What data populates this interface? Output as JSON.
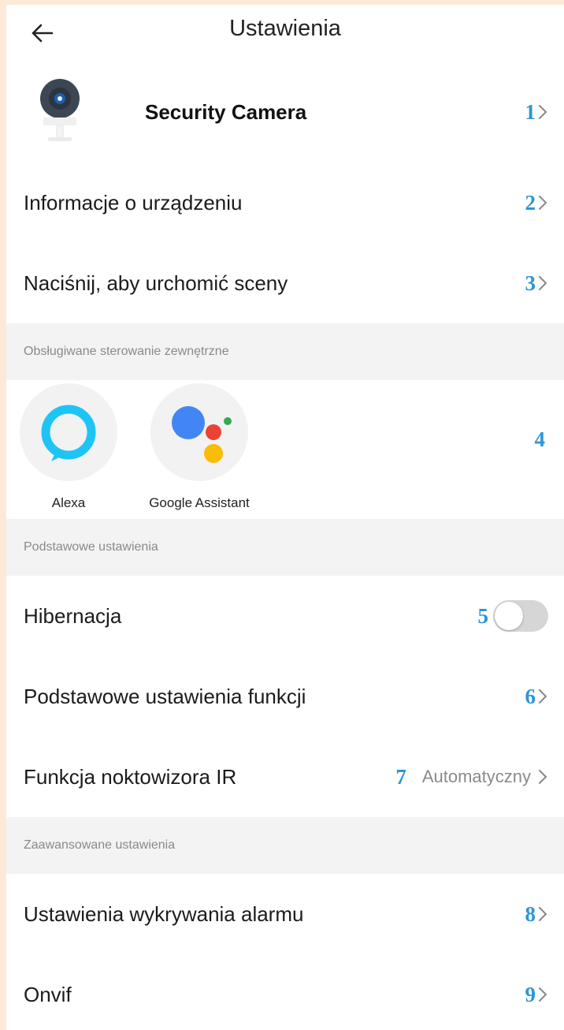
{
  "header": {
    "title": "Ustawienia"
  },
  "device": {
    "name": "Security Camera",
    "marker": "1"
  },
  "rows_top": [
    {
      "label": "Informacje o urządzeniu",
      "marker": "2"
    },
    {
      "label": "Naciśnij, aby urchomić sceny",
      "marker": "3"
    }
  ],
  "external": {
    "section_title": "Obsługiwane sterowanie zewnętrzne",
    "alexa_label": "Alexa",
    "google_label": "Google Assistant",
    "marker": "4"
  },
  "basic": {
    "section_title": "Podstawowe ustawienia",
    "hibernation": {
      "label": "Hibernacja",
      "marker": "5",
      "enabled": false
    },
    "functions": {
      "label": "Podstawowe ustawienia funkcji",
      "marker": "6"
    },
    "ir": {
      "label": "Funkcja noktowizora IR",
      "marker": "7",
      "value": "Automatyczny"
    }
  },
  "advanced": {
    "section_title": "Zaawansowane ustawienia",
    "alarm": {
      "label": "Ustawienia wykrywania alarmu",
      "marker": "8"
    },
    "onvif": {
      "label": "Onvif",
      "marker": "9"
    }
  },
  "colors": {
    "marker": "#2b96d8",
    "alexa": "#1ec4f4",
    "section_bg": "#f3f3f3",
    "page_border": "#fde9d8"
  },
  "icons": [
    "back-arrow-icon",
    "camera-icon",
    "chevron-right-icon",
    "alexa-icon",
    "google-assistant-icon"
  ]
}
